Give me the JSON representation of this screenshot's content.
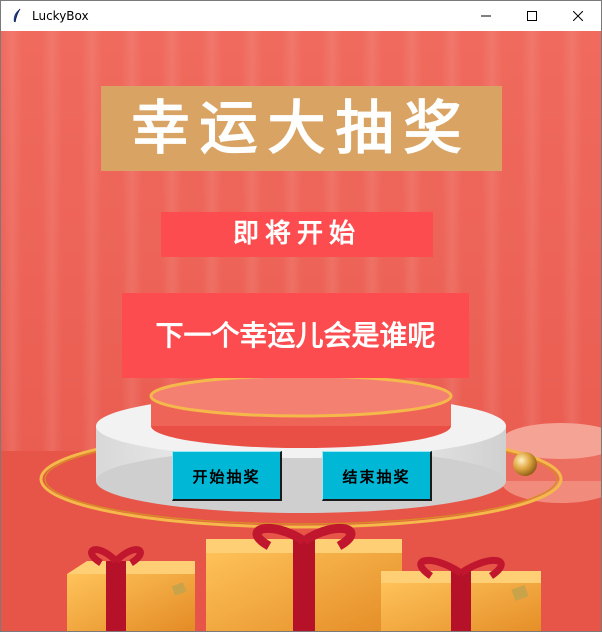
{
  "window": {
    "title": "LuckyBox",
    "controls": [
      "minimize",
      "maximize",
      "close"
    ]
  },
  "app": {
    "banner_title": "幸运大抽奖",
    "status_text": "即将开始",
    "winner_display": "下一个幸运儿会是谁呢",
    "start_button": "开始抽奖",
    "stop_button": "结束抽奖"
  },
  "colors": {
    "background": "#ec5a4f",
    "banner": "#d9a463",
    "status_box": "#fd4c4f",
    "button": "#00b7d6",
    "gift_box": "#f4a53a",
    "ribbon": "#b5122a"
  },
  "icons": {
    "app_icon": "feather-icon",
    "minimize": "minimize-icon",
    "maximize": "maximize-icon",
    "close": "close-icon"
  }
}
